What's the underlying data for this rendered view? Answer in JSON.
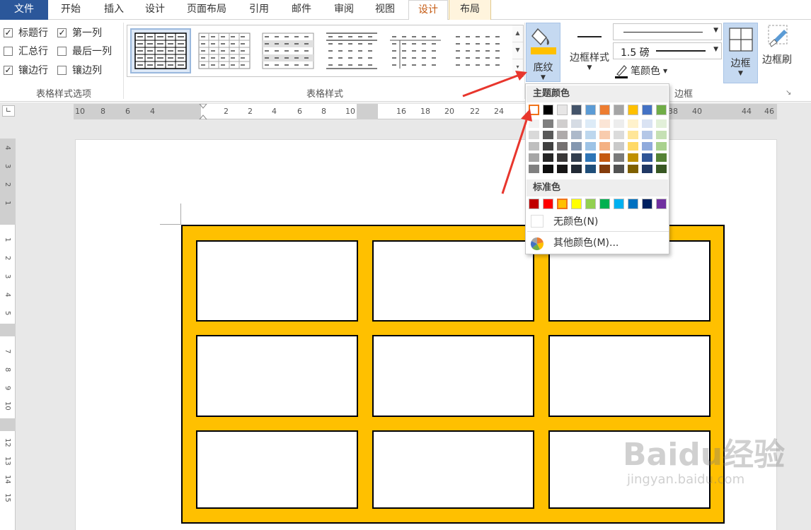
{
  "tabs": [
    {
      "label": "文件"
    },
    {
      "label": "开始"
    },
    {
      "label": "插入"
    },
    {
      "label": "设计"
    },
    {
      "label": "页面布局"
    },
    {
      "label": "引用"
    },
    {
      "label": "邮件"
    },
    {
      "label": "审阅"
    },
    {
      "label": "视图"
    },
    {
      "label": "设计"
    },
    {
      "label": "布局"
    }
  ],
  "style_options": {
    "items": [
      {
        "label": "标题行",
        "checked": true
      },
      {
        "label": "第一列",
        "checked": true
      },
      {
        "label": "汇总行",
        "checked": false
      },
      {
        "label": "最后一列",
        "checked": false
      },
      {
        "label": "镶边行",
        "checked": true
      },
      {
        "label": "镶边列",
        "checked": false
      }
    ],
    "group_label": "表格样式选项",
    "check_mark": "✓"
  },
  "table_styles": {
    "group_label": "表格样式"
  },
  "shading": {
    "label": "底纹",
    "fill_color": "#ffc000"
  },
  "borders": {
    "border_styles_label": "边框样式",
    "weight_value": "1.5 磅",
    "pen_color_label": "笔颜色",
    "borders_label": "边框",
    "border_painter_label": "边框刷",
    "group_label": "边框"
  },
  "color_menu": {
    "theme_header": "主题颜色",
    "standard_header": "标准色",
    "no_color": "无颜色(N)",
    "more_colors": "其他颜色(M)...",
    "theme_colors": [
      "#ffffff",
      "#000000",
      "#e7e6e6",
      "#44546a",
      "#5b9bd5",
      "#ed7d31",
      "#a5a5a5",
      "#ffc000",
      "#4472c4",
      "#70ad47"
    ],
    "theme_shades": [
      [
        "#f2f2f2",
        "#d9d9d9",
        "#bfbfbf",
        "#a6a6a6",
        "#808080"
      ],
      [
        "#7f7f7f",
        "#595959",
        "#404040",
        "#262626",
        "#0d0d0d"
      ],
      [
        "#d0cece",
        "#aeaaaa",
        "#757171",
        "#3a3838",
        "#171616"
      ],
      [
        "#d6dce4",
        "#adb9ca",
        "#8497b0",
        "#333f4f",
        "#222a35"
      ],
      [
        "#ddebf7",
        "#bdd7ee",
        "#9dc3e6",
        "#2e75b6",
        "#1f4e79"
      ],
      [
        "#fbe5d6",
        "#f8cbad",
        "#f4b183",
        "#c55a11",
        "#843c0c"
      ],
      [
        "#ededed",
        "#dbdbdb",
        "#c9c9c9",
        "#7b7b7b",
        "#525252"
      ],
      [
        "#fff2cc",
        "#ffe699",
        "#ffd966",
        "#bf9000",
        "#7f6000"
      ],
      [
        "#dae3f3",
        "#b4c7e7",
        "#8faadc",
        "#2f5597",
        "#203864"
      ],
      [
        "#e2f0d9",
        "#c5e0b4",
        "#a9d18e",
        "#548235",
        "#385723"
      ]
    ],
    "standard_colors": [
      "#c00000",
      "#ff0000",
      "#ffc000",
      "#ffff00",
      "#92d050",
      "#00b050",
      "#00b0f0",
      "#0070c0",
      "#002060",
      "#7030a0"
    ]
  },
  "ruler": {
    "h_numbers": [
      "10",
      "8",
      "6",
      "4",
      "2",
      "2",
      "4",
      "6",
      "8",
      "10",
      "16",
      "18",
      "20",
      "22",
      "24",
      "38",
      "40",
      "44",
      "46"
    ],
    "v_numbers": [
      "4",
      "3",
      "2",
      "1",
      "1",
      "2",
      "3",
      "4",
      "5",
      "7",
      "8",
      "9",
      "10",
      "12",
      "13",
      "14",
      "15"
    ]
  },
  "watermark": {
    "line1": "Baidu经验",
    "line2": "jingyan.baidu.com"
  }
}
